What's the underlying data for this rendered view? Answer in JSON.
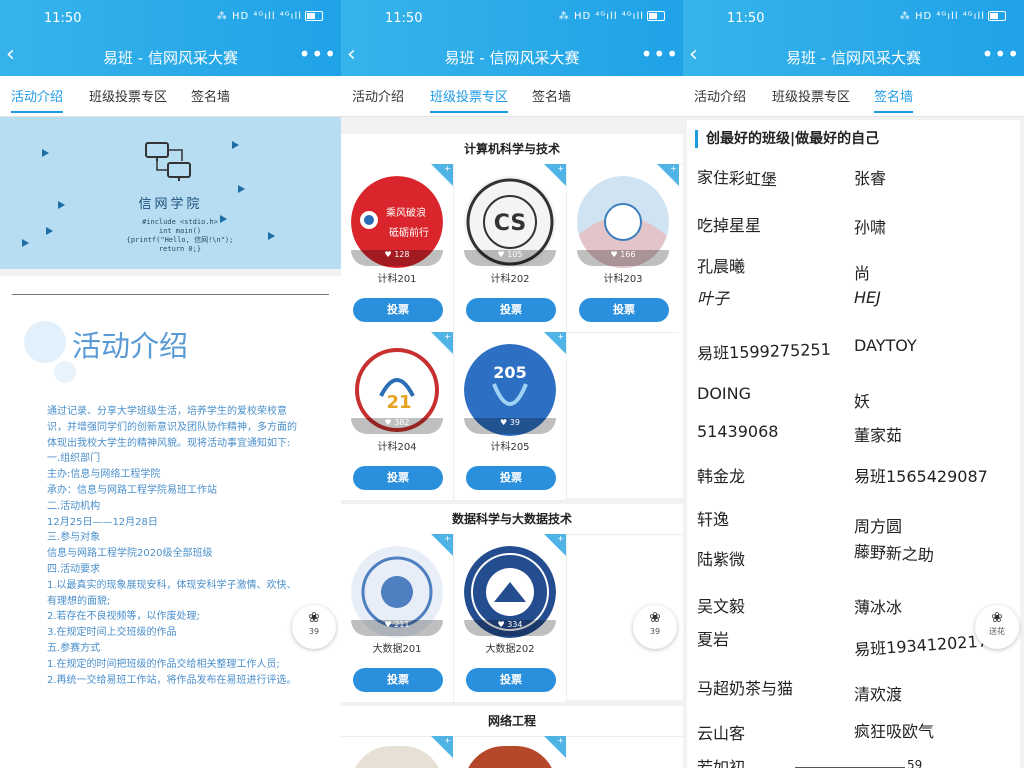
{
  "status": {
    "time": "11:50",
    "icons": "⁂ HD ⁴ᴳıll ⁴ᴳıll"
  },
  "titlebar": {
    "title": "易班 - 信网风采大赛",
    "back": "‹",
    "more": "•••"
  },
  "tabs": [
    "活动介绍",
    "班级投票专区",
    "签名墙"
  ],
  "hero": {
    "school": "信网学院",
    "code": "#include <stdio.h>\nint main()\n{printf(\"Hello, 信网!\\n\");\nreturn 0;}"
  },
  "intro": {
    "heading": "活动介绍",
    "lines": [
      "通过记录、分享大学班级生活，培养学生的爱校荣校意识，并增强同学们的创新意识及团队协作精神，多方面的体现出我校大学生的精神风貌。现将活动事宜通知如下:",
      "一.组织部门",
      "主办:信息与网络工程学院",
      "承办：信息与网路工程学院易班工作站",
      "二.活动机构",
      "12月25日——12月28日",
      "三.参与对象",
      "信息与网路工程学院2020级全部班级",
      "四.活动要求",
      "1.以最真实的现象展现安科，体现安科学子激情、欢快、有理想的面貌;",
      "2.若存在不良视频等，以作废处理;",
      "3.在规定时间上交班级的作品",
      "五.参赛方式",
      "1.在规定的时间把班级的作品交给相关整理工作人员;",
      "2.再统一交给易班工作站，将作品发布在易班进行评选。"
    ]
  },
  "flower": {
    "icon": "❀",
    "count_1": "39",
    "count_2": "39",
    "label_3": "送花"
  },
  "sections": [
    {
      "name": "计算机科学与技术",
      "classes": [
        {
          "name": "计科201",
          "votes": "128",
          "vote": "投票",
          "color": "#d9252b",
          "badge": "聚风破浪 砥砺前行"
        },
        {
          "name": "计科202",
          "votes": "105",
          "vote": "投票",
          "color": "#6b6b6b",
          "badge": "计算机科学与技术202"
        },
        {
          "name": "计科203",
          "votes": "166",
          "vote": "投票",
          "color": "#9fc7e8",
          "badge": ""
        },
        {
          "name": "计科204",
          "votes": "382",
          "vote": "投票",
          "color": "#c7302f",
          "badge": ""
        },
        {
          "name": "计科205",
          "votes": "39",
          "vote": "投票",
          "color": "#2d6fc2",
          "badge": "205"
        }
      ]
    },
    {
      "name": "数据科学与大数据技术",
      "classes": [
        {
          "name": "大数据201",
          "votes": "211",
          "vote": "投票",
          "color": "#4e7fc1",
          "badge": ""
        },
        {
          "name": "大数据202",
          "votes": "334",
          "vote": "投票",
          "color": "#244d8f",
          "badge": ""
        }
      ]
    },
    {
      "name": "网络工程",
      "classes": []
    }
  ],
  "wall": {
    "heading": "创最好的班级|做最好的自己",
    "signatures": [
      "家住彩虹堡",
      "张睿",
      "吃掉星星",
      "孙啸",
      "孔晨曦",
      "尚",
      "叶子",
      "HEJ",
      "易班1599275251",
      "DAYTOY",
      "DOING",
      "妖",
      "51439068",
      "董家茹",
      "韩金龙",
      "易班1565429087",
      "轩逸",
      "周方圆",
      "陆紫微",
      "藤野新之助",
      "吴文毅",
      "薄冰冰",
      "夏岩",
      "易班1934120217",
      "马超奶茶与猫",
      "清欢渡",
      "云山客",
      "疯狂吸欧气",
      "若如初",
      "59"
    ]
  }
}
